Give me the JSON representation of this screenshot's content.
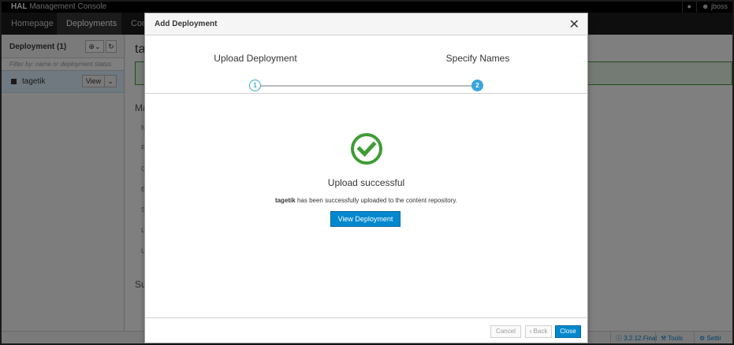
{
  "app": {
    "brand_bold": "HAL",
    "brand_rest": " Management Console",
    "user": "jboss"
  },
  "nav": {
    "items": [
      {
        "label": "Homepage"
      },
      {
        "label": "Deployments"
      },
      {
        "label": "Conf"
      }
    ]
  },
  "sidebar": {
    "title": "Deployment (1)",
    "filter_placeholder": "Filter by: name or deployment status",
    "items": [
      {
        "label": "tagetik",
        "view_label": "View"
      }
    ]
  },
  "main": {
    "title": "tag",
    "section1": "Ma",
    "section2": "Sul",
    "row_letters": [
      "N",
      "R",
      "C",
      "E",
      "S",
      "L",
      "L"
    ]
  },
  "footer": {
    "version": "3.2.12.Final",
    "tools": "Tools",
    "settings": "Settir"
  },
  "modal": {
    "title": "Add Deployment",
    "steps": [
      {
        "label": "Upload Deployment",
        "number": "1"
      },
      {
        "label": "Specify Names",
        "number": "2"
      }
    ],
    "success_title": "Upload successful",
    "success_name": "tagetik",
    "success_message": " has been successfully uploaded to the content repository.",
    "view_button": "View Deployment",
    "buttons": {
      "cancel": "Cancel",
      "back": "‹ Back",
      "close": "Close"
    }
  },
  "colors": {
    "accent": "#0088ce",
    "success": "#3f9c35",
    "step": "#39a5dc"
  }
}
